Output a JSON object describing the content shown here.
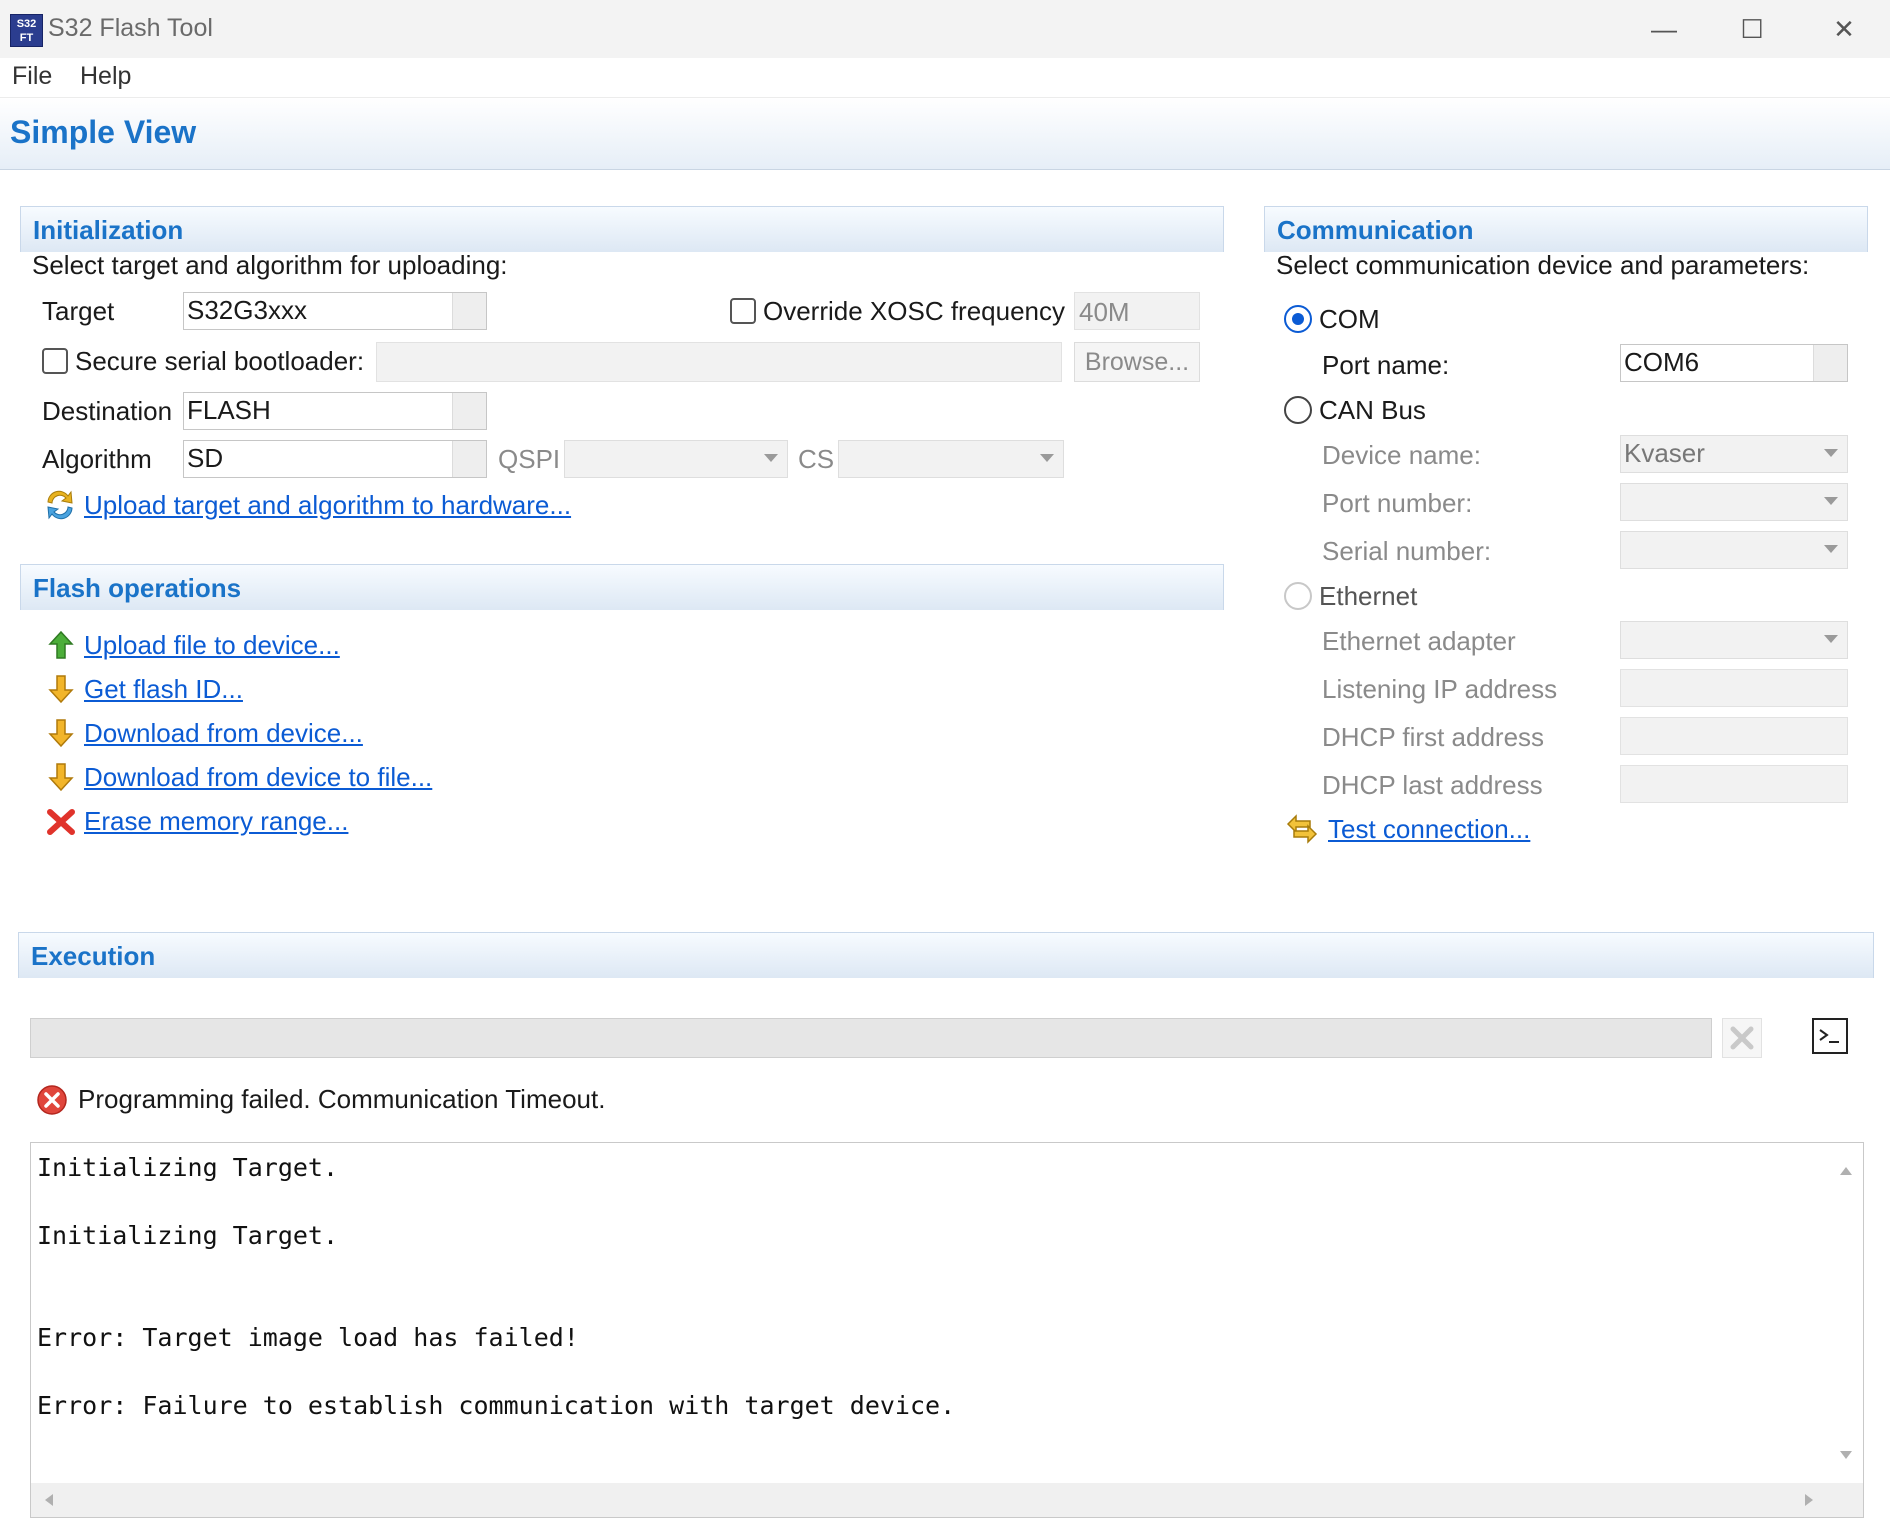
{
  "window": {
    "title": "S32 Flash Tool",
    "icon_text": "S32\nFT",
    "controls": {
      "minimize": "—",
      "maximize": "☐",
      "close": "✕"
    }
  },
  "menu": {
    "file": "File",
    "help": "Help"
  },
  "view": {
    "title": "Simple View"
  },
  "initialization": {
    "title": "Initialization",
    "subtitle": "Select target and algorithm for uploading:",
    "target_label": "Target",
    "target_value": "S32G3xxx",
    "override_label": "Override XOSC frequency",
    "override_checked": false,
    "xosc_value": "40M",
    "secure_label": "Secure serial bootloader:",
    "secure_checked": false,
    "browse_label": "Browse...",
    "destination_label": "Destination",
    "destination_value": "FLASH",
    "algorithm_label": "Algorithm",
    "algorithm_value": "SD",
    "qspi_label": "QSPI",
    "cs_label": "CS",
    "upload_link": "Upload target and algorithm to hardware..."
  },
  "flash_ops": {
    "title": "Flash operations",
    "items": [
      {
        "label": "Upload file to device...",
        "icon": "arrow-up-green-icon"
      },
      {
        "label": "Get flash ID...",
        "icon": "arrow-down-yellow-icon"
      },
      {
        "label": "Download from device...",
        "icon": "arrow-down-yellow-icon"
      },
      {
        "label": "Download from device to file...",
        "icon": "arrow-down-yellow-icon"
      },
      {
        "label": "Erase memory range...",
        "icon": "red-x-icon"
      }
    ]
  },
  "communication": {
    "title": "Communication",
    "subtitle": "Select communication device and parameters:",
    "com_label": "COM",
    "port_name_label": "Port name:",
    "port_name_value": "COM6",
    "can_label": "CAN Bus",
    "device_name_label": "Device name:",
    "device_name_value": "Kvaser",
    "port_number_label": "Port number:",
    "serial_number_label": "Serial number:",
    "ethernet_label": "Ethernet",
    "eth_adapter_label": "Ethernet adapter",
    "listen_ip_label": "Listening IP address",
    "dhcp_first_label": "DHCP first address",
    "dhcp_last_label": "DHCP last address",
    "test_link": "Test connection...",
    "selected": "COM"
  },
  "execution": {
    "title": "Execution",
    "status": "Programming failed. Communication Timeout.",
    "log": "Initializing Target.\n\nInitializing Target.\n\n\nError: Target image load has failed!\n\nError: Failure to establish communication with target device."
  },
  "colors": {
    "accent": "#1a73c8",
    "link": "#0b5bd4",
    "error": "#d9342b"
  }
}
